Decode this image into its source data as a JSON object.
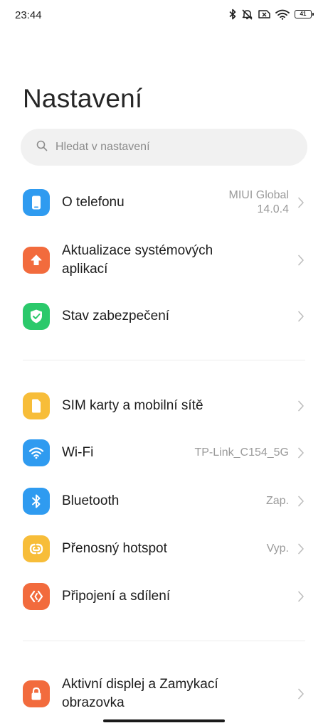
{
  "status_bar": {
    "time": "23:44",
    "battery_level": "41",
    "icons": [
      "bluetooth-icon",
      "mute-icon",
      "no-sim-icon",
      "wifi-icon",
      "battery-icon"
    ]
  },
  "header": {
    "title": "Nastavení"
  },
  "search": {
    "placeholder": "Hledat v nastavení"
  },
  "sections": [
    {
      "items": [
        {
          "label": "O telefonu",
          "value_line1": "MIUI Global",
          "value_line2": "14.0.4",
          "icon": "phone-icon",
          "color": "#2f9bf0"
        },
        {
          "label_line1": "Aktualizace systémových",
          "label_line2": "aplikací",
          "icon": "arrow-up-icon",
          "color": "#f26b3d"
        },
        {
          "label": "Stav zabezpečení",
          "icon": "shield-check-icon",
          "color": "#2bc96b"
        }
      ]
    },
    {
      "items": [
        {
          "label": "SIM karty a mobilní sítě",
          "icon": "sim-card-icon",
          "color": "#f7bd39"
        },
        {
          "label": "Wi-Fi",
          "value": "TP-Link_C154_5G",
          "icon": "wifi-icon",
          "color": "#2f9bf0"
        },
        {
          "label": "Bluetooth",
          "value": "Zap.",
          "icon": "bluetooth-icon",
          "color": "#2f9bf0"
        },
        {
          "label": "Přenosný hotspot",
          "value": "Vyp.",
          "icon": "hotspot-icon",
          "color": "#f7bd39"
        },
        {
          "label": "Připojení a sdílení",
          "icon": "connection-share-icon",
          "color": "#f26b3d"
        }
      ]
    },
    {
      "items": [
        {
          "label_line1": "Aktivní displej a Zamykací",
          "label_line2": "obrazovka",
          "icon": "lock-icon",
          "color": "#f26b3d"
        }
      ]
    }
  ]
}
